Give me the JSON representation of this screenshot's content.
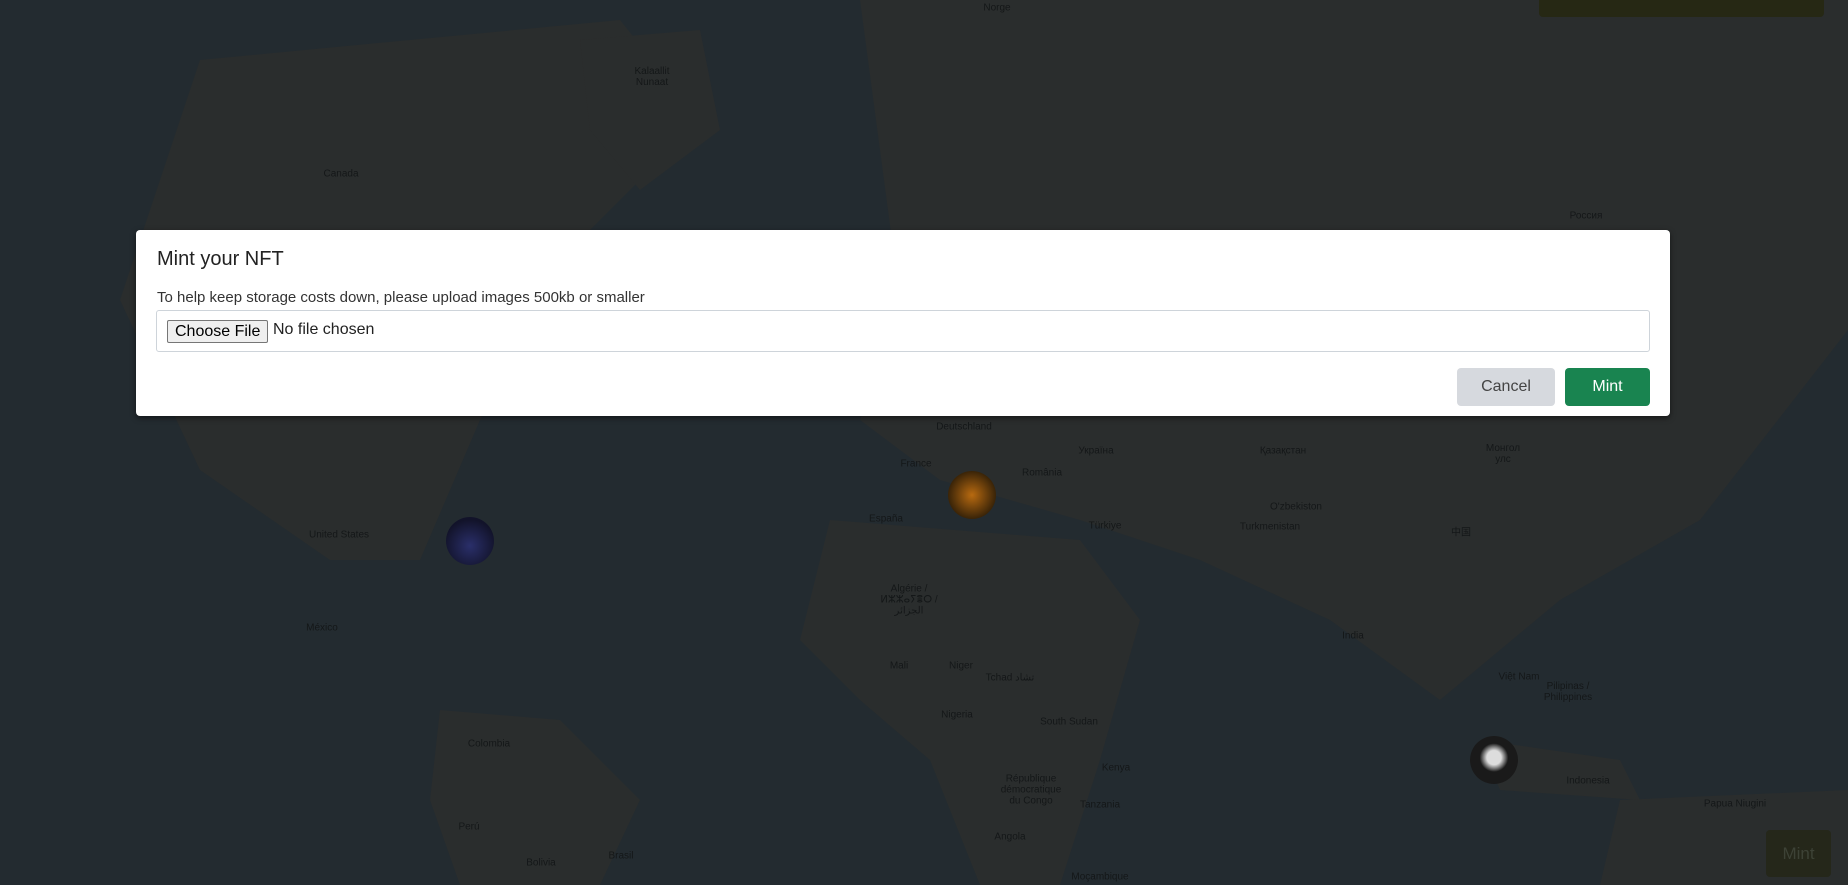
{
  "map": {
    "labels": [
      "Norge",
      "Kalaallit Nunaat",
      "Canada",
      "Россия",
      "Deutschland",
      "France",
      "România",
      "Україна",
      "Қазақстан",
      "Монгол улс",
      "España",
      "Türkiye",
      "O'zbekiston",
      "Turkmenistan",
      "United States",
      "中国",
      "México",
      "Algérie / ⵍⵣⵣⴰⵢⴻⵔ / الجزائر",
      "Mali",
      "Niger",
      "Tchad تشاد",
      "India",
      "Việt Nam",
      "Pilipinas / Philippines",
      "Nigeria",
      "South Sudan",
      "Colombia",
      "Kenya",
      "Indonesia",
      "République démocratique du Congo",
      "Tanzania",
      "Papua Niugini",
      "Perú",
      "Brasil",
      "Angola",
      "Bolivia",
      "Moçambique"
    ],
    "mint_button": "Mint"
  },
  "modal": {
    "title": "Mint your NFT",
    "help_text": "To help keep storage costs down, please upload images 500kb or smaller",
    "choose_file": "Choose File",
    "no_file": "No file chosen",
    "cancel": "Cancel",
    "mint": "Mint"
  },
  "colors": {
    "mint_green": "#198450",
    "cancel_gray": "#d6d9de"
  }
}
